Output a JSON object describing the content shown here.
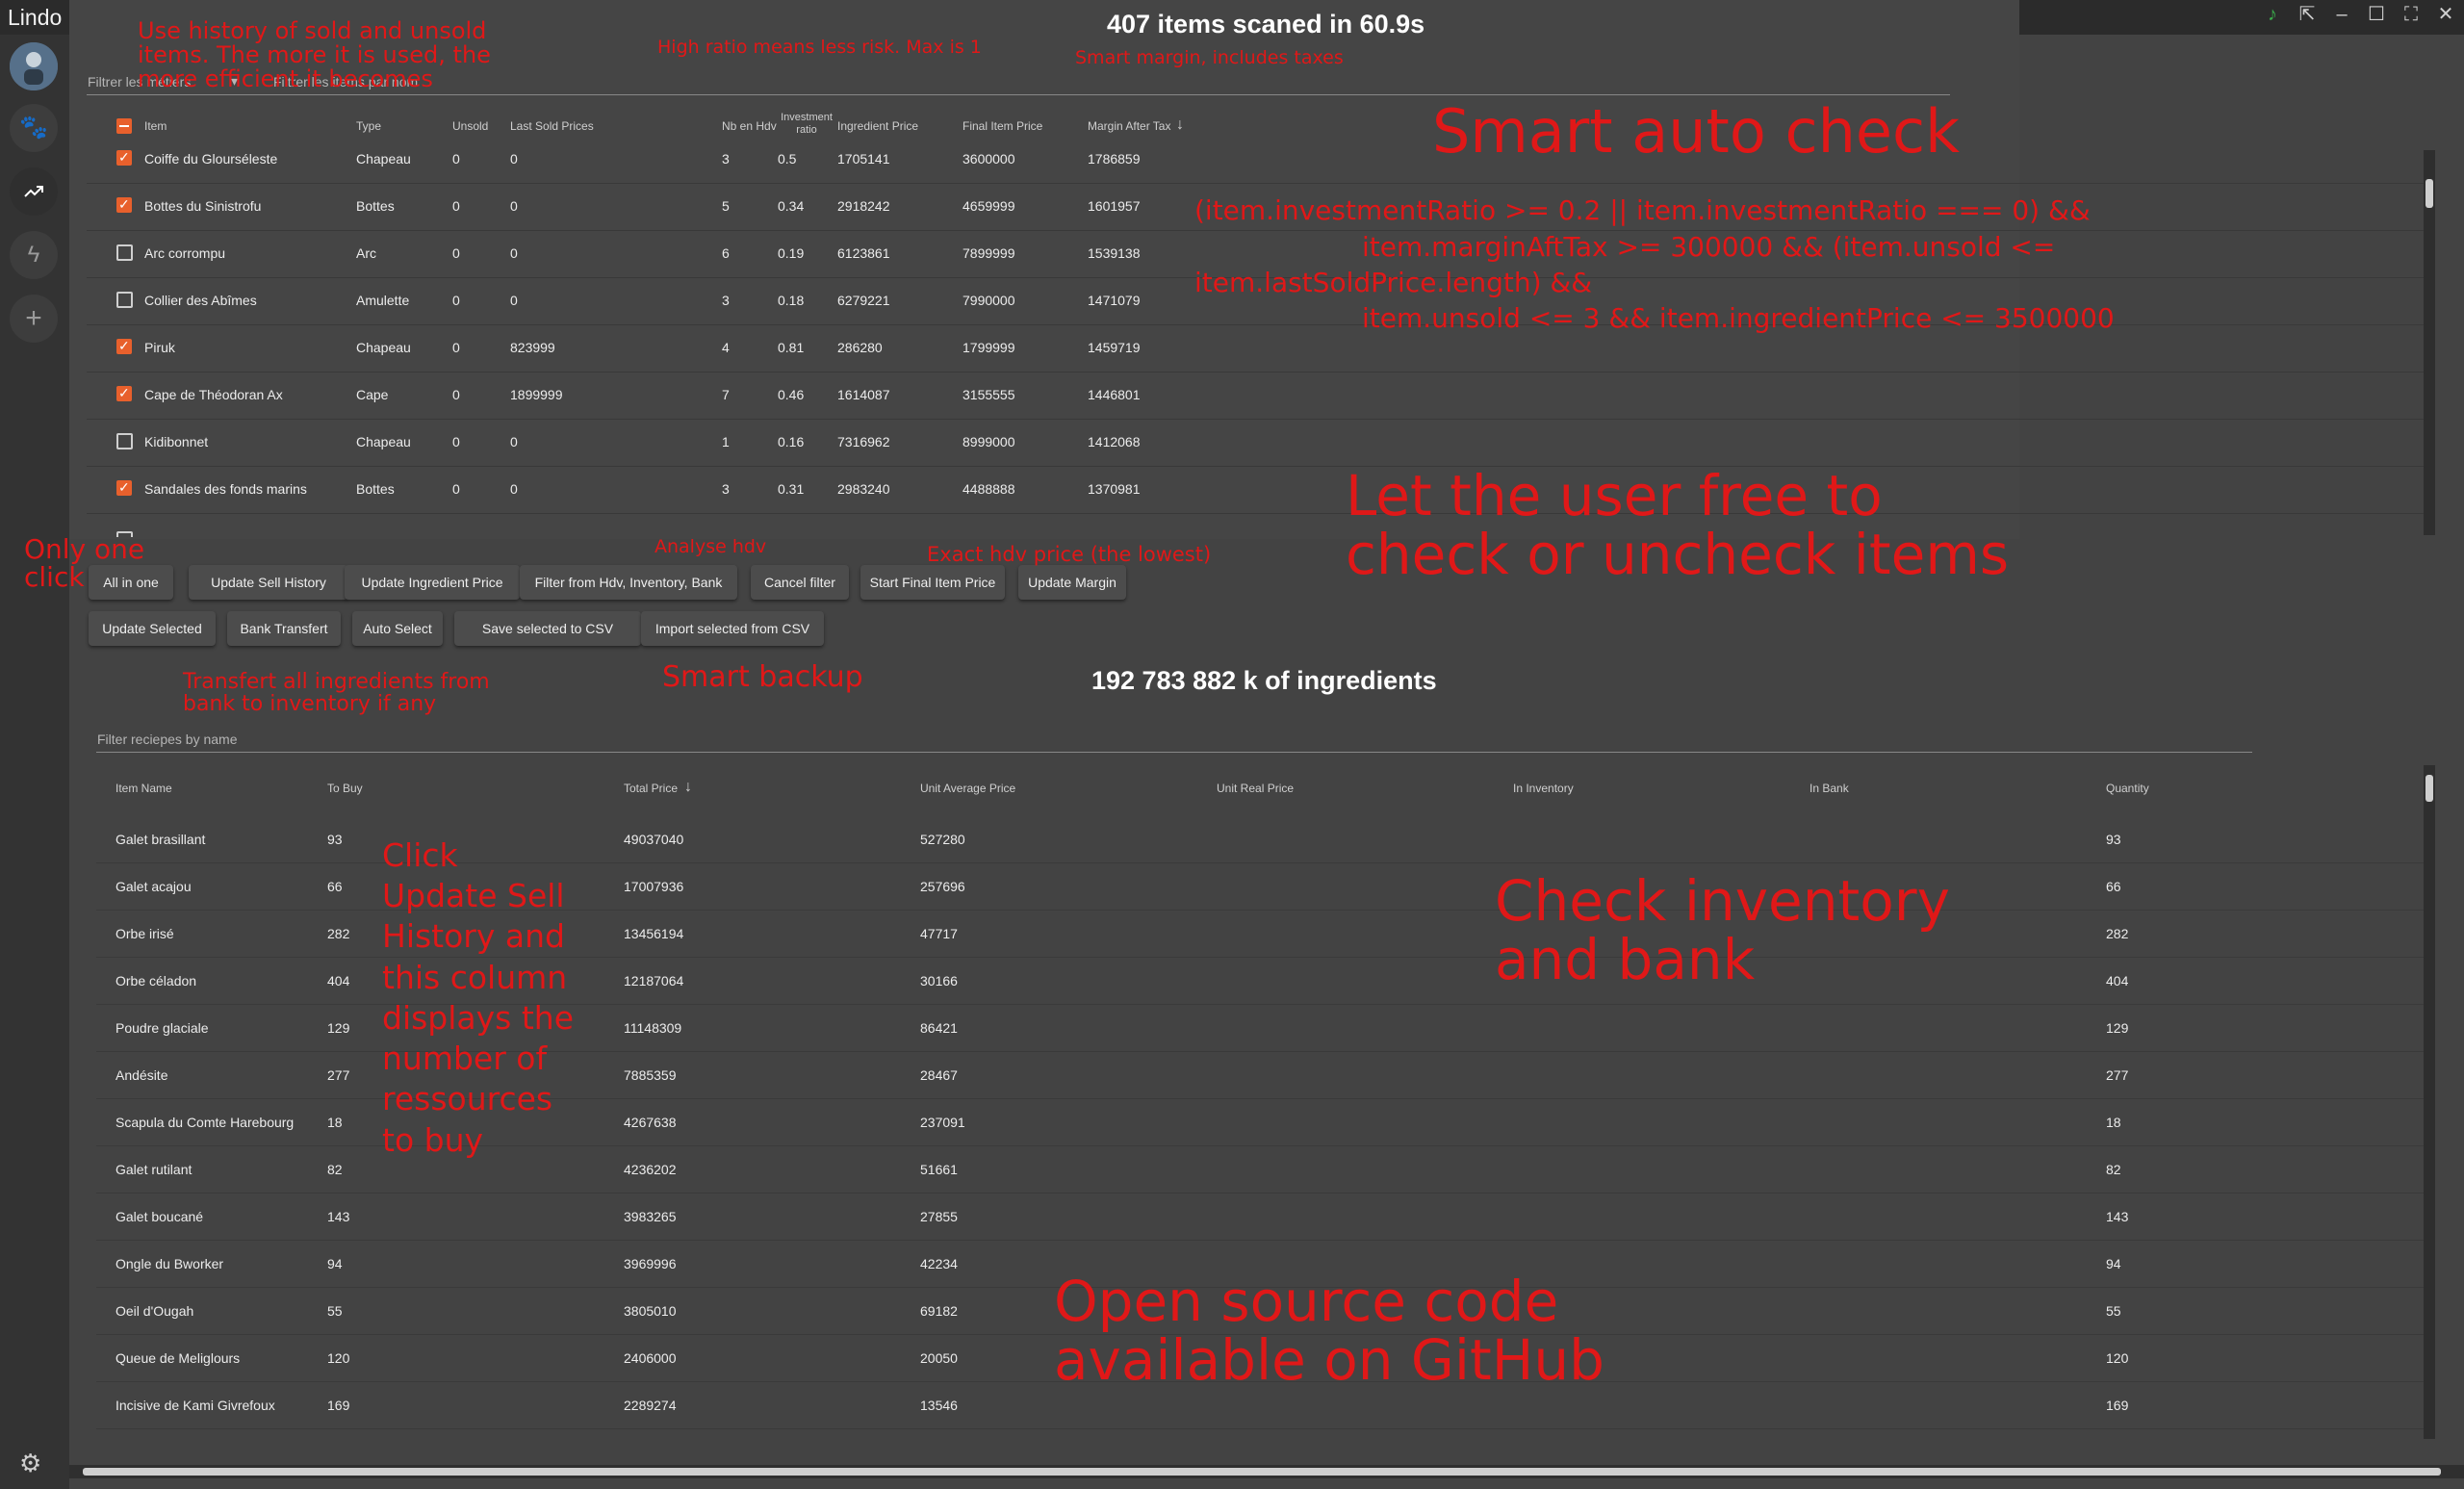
{
  "window": {
    "app_title": "Lindo"
  },
  "scan": {
    "title": "407 items scaned in 60.9s"
  },
  "filters": {
    "metiers_placeholder": "Filtrer les métiers",
    "items_placeholder": "Filtrer les items par nom"
  },
  "items_table": {
    "headers": {
      "item": "Item",
      "type": "Type",
      "unsold": "Unsold",
      "last_sold": "Last Sold Prices",
      "nb_hdv": "Nb en Hdv",
      "investment_ratio": "Investment ratio",
      "ingredient_price": "Ingredient Price",
      "final_item_price": "Final Item Price",
      "margin_after_tax": "Margin After Tax"
    },
    "rows": [
      {
        "checked": true,
        "item": "Coiffe du Glourséleste",
        "type": "Chapeau",
        "unsold": "0",
        "last_sold": "0",
        "nb_hdv": "3",
        "ratio": "0.5",
        "ingredient": "1705141",
        "final": "3600000",
        "margin": "1786859"
      },
      {
        "checked": true,
        "item": "Bottes du Sinistrofu",
        "type": "Bottes",
        "unsold": "0",
        "last_sold": "0",
        "nb_hdv": "5",
        "ratio": "0.34",
        "ingredient": "2918242",
        "final": "4659999",
        "margin": "1601957"
      },
      {
        "checked": false,
        "item": "Arc corrompu",
        "type": "Arc",
        "unsold": "0",
        "last_sold": "0",
        "nb_hdv": "6",
        "ratio": "0.19",
        "ingredient": "6123861",
        "final": "7899999",
        "margin": "1539138"
      },
      {
        "checked": false,
        "item": "Collier des Abîmes",
        "type": "Amulette",
        "unsold": "0",
        "last_sold": "0",
        "nb_hdv": "3",
        "ratio": "0.18",
        "ingredient": "6279221",
        "final": "7990000",
        "margin": "1471079"
      },
      {
        "checked": true,
        "item": "Piruk",
        "type": "Chapeau",
        "unsold": "0",
        "last_sold": "823999",
        "nb_hdv": "4",
        "ratio": "0.81",
        "ingredient": "286280",
        "final": "1799999",
        "margin": "1459719"
      },
      {
        "checked": true,
        "item": "Cape de Théodoran Ax",
        "type": "Cape",
        "unsold": "0",
        "last_sold": "1899999",
        "nb_hdv": "7",
        "ratio": "0.46",
        "ingredient": "1614087",
        "final": "3155555",
        "margin": "1446801"
      },
      {
        "checked": false,
        "item": "Kidibonnet",
        "type": "Chapeau",
        "unsold": "0",
        "last_sold": "0",
        "nb_hdv": "1",
        "ratio": "0.16",
        "ingredient": "7316962",
        "final": "8999000",
        "margin": "1412068"
      },
      {
        "checked": true,
        "item": "Sandales des fonds marins",
        "type": "Bottes",
        "unsold": "0",
        "last_sold": "0",
        "nb_hdv": "3",
        "ratio": "0.31",
        "ingredient": "2983240",
        "final": "4488888",
        "margin": "1370981"
      }
    ]
  },
  "buttons_row1": [
    "All in one",
    "Update Sell History",
    "Update Ingredient Price",
    "Filter from Hdv, Inventory, Bank",
    "Cancel filter",
    "Start Final Item Price",
    "Update Margin"
  ],
  "buttons_row2": [
    "Update Selected",
    "Bank Transfert",
    "Auto Select",
    "Save selected to CSV",
    "Import selected from CSV"
  ],
  "ingredients": {
    "total": "192 783 882 k of ingredients",
    "filter_placeholder": "Filter reciepes by name",
    "headers": {
      "name": "Item Name",
      "to_buy": "To Buy",
      "total_price": "Total Price",
      "unit_avg": "Unit Average Price",
      "unit_real": "Unit Real Price",
      "inventory": "In Inventory",
      "bank": "In Bank",
      "quantity": "Quantity"
    },
    "rows": [
      {
        "name": "Galet brasillant",
        "to_buy": "93",
        "total": "49037040",
        "unit_avg": "527280",
        "qty": "93"
      },
      {
        "name": "Galet acajou",
        "to_buy": "66",
        "total": "17007936",
        "unit_avg": "257696",
        "qty": "66"
      },
      {
        "name": "Orbe irisé",
        "to_buy": "282",
        "total": "13456194",
        "unit_avg": "47717",
        "qty": "282"
      },
      {
        "name": "Orbe céladon",
        "to_buy": "404",
        "total": "12187064",
        "unit_avg": "30166",
        "qty": "404"
      },
      {
        "name": "Poudre glaciale",
        "to_buy": "129",
        "total": "11148309",
        "unit_avg": "86421",
        "qty": "129"
      },
      {
        "name": "Andésite",
        "to_buy": "277",
        "total": "7885359",
        "unit_avg": "28467",
        "qty": "277"
      },
      {
        "name": "Scapula du Comte Harebourg",
        "to_buy": "18",
        "total": "4267638",
        "unit_avg": "237091",
        "qty": "18"
      },
      {
        "name": "Galet rutilant",
        "to_buy": "82",
        "total": "4236202",
        "unit_avg": "51661",
        "qty": "82"
      },
      {
        "name": "Galet boucané",
        "to_buy": "143",
        "total": "3983265",
        "unit_avg": "27855",
        "qty": "143"
      },
      {
        "name": "Ongle du Bworker",
        "to_buy": "94",
        "total": "3969996",
        "unit_avg": "42234",
        "qty": "94"
      },
      {
        "name": "Oeil d'Ougah",
        "to_buy": "55",
        "total": "3805010",
        "unit_avg": "69182",
        "qty": "55"
      },
      {
        "name": "Queue de Meliglours",
        "to_buy": "120",
        "total": "2406000",
        "unit_avg": "20050",
        "qty": "120"
      },
      {
        "name": "Incisive de Kami Givrefoux",
        "to_buy": "169",
        "total": "2289274",
        "unit_avg": "13546",
        "qty": "169"
      }
    ]
  },
  "annotations": {
    "history": "Use history of sold and unsold\nitems. The more it is used, the\nmore efficient it becomes",
    "ratio": "High ratio means less risk. Max is 1",
    "margin": "Smart margin, includes taxes",
    "auto_check": "Smart auto check",
    "formula1": "(item.investmentRatio >= 0.2 || item.investmentRatio === 0) &&",
    "formula2": "item.marginAftTax >= 300000 && (item.unsold <=",
    "formula3": "item.lastSoldPrice.length) &&",
    "formula4": "item.unsold <= 3 && item.ingredientPrice <= 3500000",
    "free": "Let the user free to\ncheck or uncheck items",
    "one_click": "Only one\nclick",
    "analyse": "Analyse hdv",
    "exact": "Exact hdv price (the lowest)",
    "transfer": "Transfert all ingredients from\nbank to inventory if any",
    "backup": "Smart backup",
    "click_update": "Click\nUpdate Sell\nHistory and\nthis column\ndisplays the\nnumber of\nressources\nto buy",
    "inventory": "Check inventory\nand bank",
    "open_source": "Open source code\navailable on GitHub"
  },
  "colors": {
    "accent": "#e8602c",
    "annotation": "#e01818",
    "background": "#434343"
  }
}
